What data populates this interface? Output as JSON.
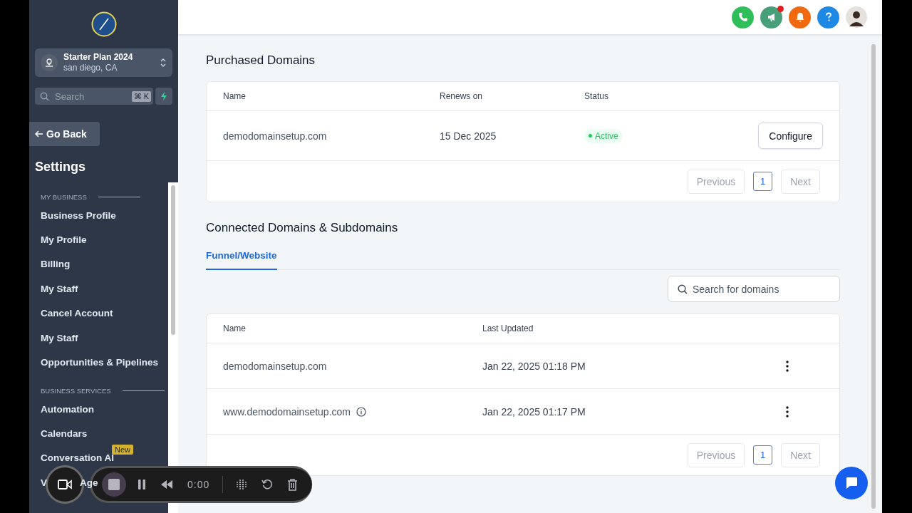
{
  "sidebar": {
    "account": {
      "name": "Starter Plan 2024",
      "location": "san diego, CA"
    },
    "search": {
      "placeholder": "Search",
      "shortcut": "⌘ K"
    },
    "back_button": "Go Back",
    "title": "Settings",
    "sections": [
      {
        "heading": "MY BUSINESS",
        "items": [
          {
            "label": "Business Profile"
          },
          {
            "label": "My Profile"
          },
          {
            "label": "Billing"
          },
          {
            "label": "My Staff"
          },
          {
            "label": "Cancel Account"
          },
          {
            "label": "My Staff"
          },
          {
            "label": "Opportunities & Pipelines"
          }
        ]
      },
      {
        "heading": "BUSINESS SERVICES",
        "items": [
          {
            "label": "Automation"
          },
          {
            "label": "Calendars"
          },
          {
            "label": "Conversation AI",
            "badge": "New"
          },
          {
            "label_parts": [
              "V",
              "Age"
            ]
          }
        ]
      }
    ]
  },
  "purchased": {
    "title": "Purchased Domains",
    "columns": [
      "Name",
      "Renews on",
      "Status"
    ],
    "rows": [
      {
        "name": "demodomainsetup.com",
        "renews": "15 Dec 2025",
        "status": "Active",
        "action": "Configure"
      }
    ],
    "pagination": {
      "previous": {
        "label": "Previous",
        "disabled": true
      },
      "pages": [
        {
          "label": "1",
          "selected": true
        }
      ],
      "next": {
        "label": "Next",
        "disabled": true
      }
    }
  },
  "connected": {
    "title": "Connected Domains & Subdomains",
    "tabs": [
      {
        "label": "Funnel/Website",
        "selected": true
      }
    ],
    "search": {
      "placeholder": "Search for domains"
    },
    "columns": [
      "Name",
      "Last Updated"
    ],
    "rows": [
      {
        "name": "demodomainsetup.com",
        "updated": "Jan 22, 2025 01:18 PM",
        "info": false
      },
      {
        "name": "www.demodomainsetup.com",
        "updated": "Jan 22, 2025 01:17 PM",
        "info": true
      }
    ],
    "pagination": {
      "previous": {
        "label": "Previous",
        "disabled": true
      },
      "pages": [
        {
          "label": "1",
          "selected": true
        }
      ],
      "next": {
        "label": "Next",
        "disabled": true
      }
    }
  },
  "recorder": {
    "time": "0:00"
  }
}
